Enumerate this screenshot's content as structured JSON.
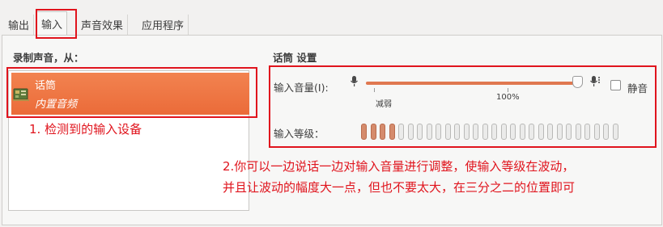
{
  "tabs": [
    {
      "label": "输出",
      "active": false
    },
    {
      "label": "输入",
      "active": true
    },
    {
      "label": "声音效果",
      "active": false
    },
    {
      "label": "应用程序",
      "active": false
    }
  ],
  "input_panel": {
    "record_from_title": "录制声音，从：",
    "devices": [
      {
        "name": "话筒",
        "description": "内置音频",
        "selected": true,
        "icon": "sound-card-icon"
      }
    ],
    "settings_title": "话筒 设置",
    "input_volume_label": "输入音量(I):",
    "volume_percent": 100,
    "volume_ticks": {
      "low_label": "减弱",
      "full_label": "100%"
    },
    "mute_label": "静音",
    "mute_checked": false,
    "input_level_label": "输入等级：",
    "level_bars_total": 28,
    "level_bars_active": 4
  },
  "annotations": {
    "note1": "1. 检测到的输入设备",
    "note2_line1": "2.你可以一边说话一边对输入音量进行调整，使输入等级在波动，",
    "note2_line2": "并且让波动的幅度大一点，但也不要太大，在三分之二的位置即可"
  },
  "colors": {
    "selection": "#f07746",
    "annotation_red": "#e0141d",
    "slider_fill": "#e07850"
  }
}
